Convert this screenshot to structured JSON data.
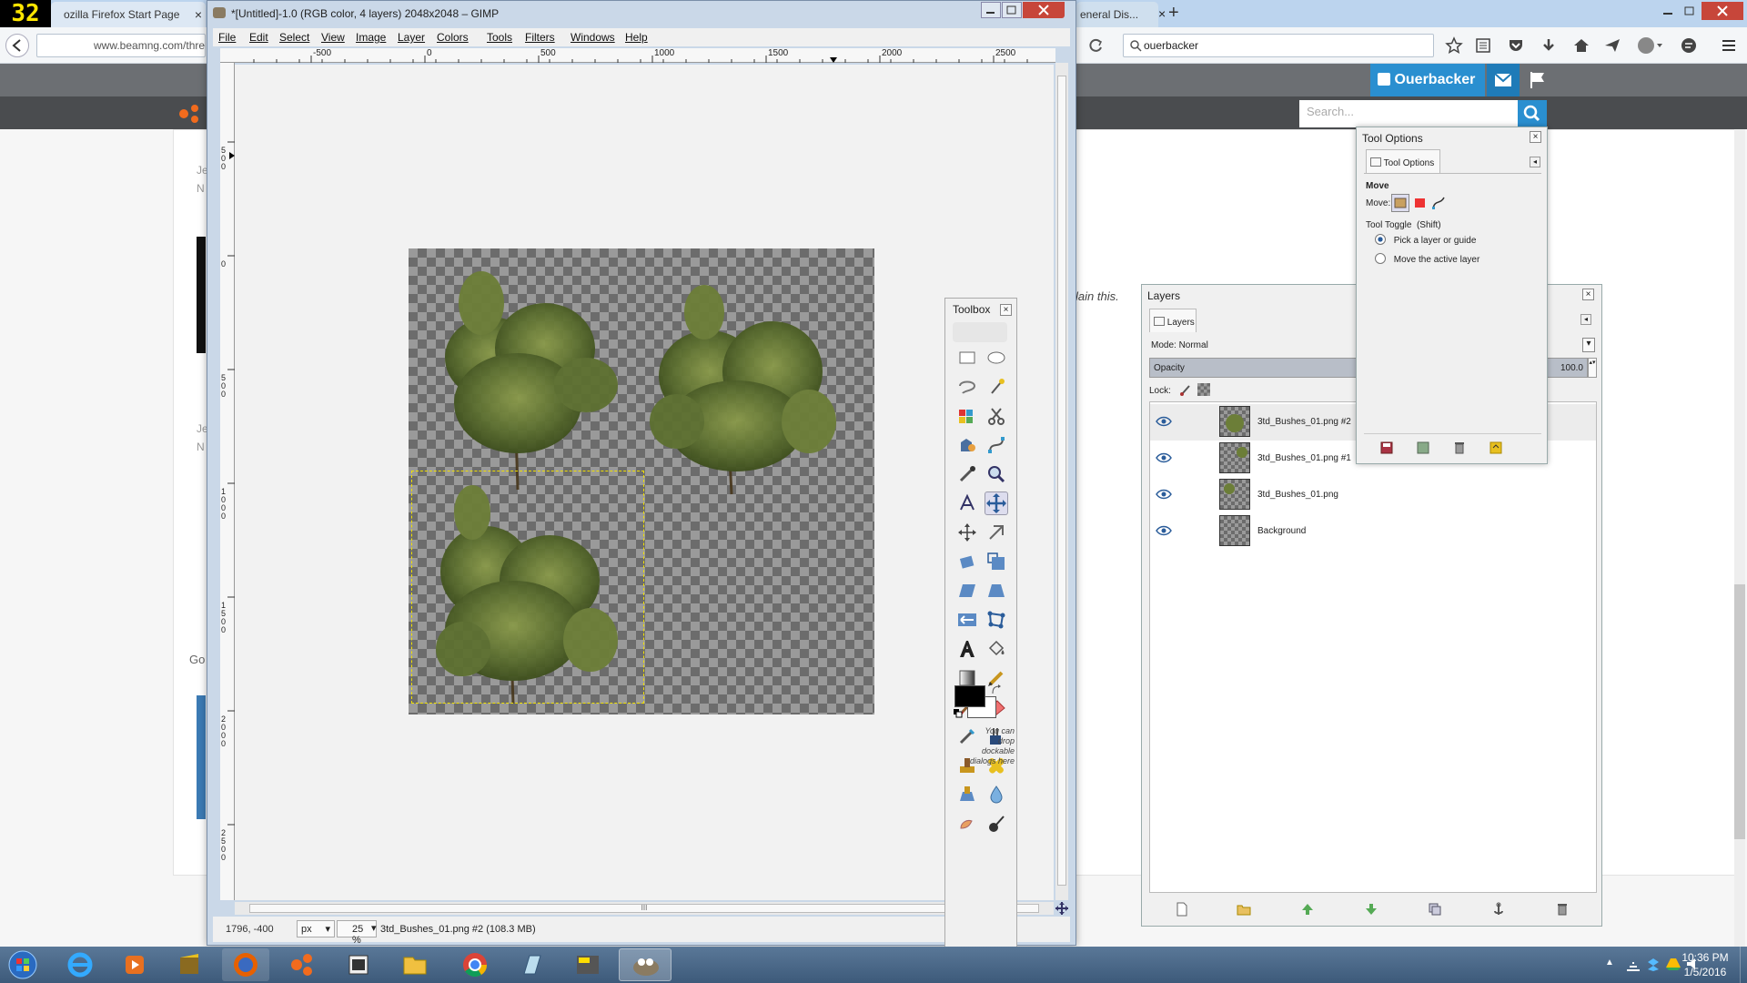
{
  "browser": {
    "tab_label": "ozilla Firefox Start Page",
    "right_tab_label": "eneral Dis...",
    "tab_close_glyph": "×",
    "new_tab_glyph": "+",
    "url": "www.beamng.com/thre",
    "search_value": "ouerbacker",
    "counter_badge": "32"
  },
  "site": {
    "user_name": "Ouerbacker",
    "search_placeholder": "Search...",
    "side_snippet_1": "Je",
    "side_snippet_2": "N",
    "side_snippet_3": "Je",
    "side_snippet_4": "N",
    "side_snippet_5": "Go",
    "explain_text": "lain this."
  },
  "gimp": {
    "title": "*[Untitled]-1.0 (RGB color, 4 layers) 2048x2048 – GIMP",
    "menus": [
      "File",
      "Edit",
      "Select",
      "View",
      "Image",
      "Layer",
      "Colors",
      "Tools",
      "Filters",
      "Windows",
      "Help"
    ],
    "ruler_labels": [
      "-500",
      "0",
      "500",
      "1000",
      "1500",
      "2000",
      "2500"
    ],
    "vruler_labels": [
      "500",
      "0",
      "500",
      "1000",
      "1500",
      "2000",
      "2500"
    ],
    "coords": "1796, -400",
    "unit": "px",
    "zoom": "25 %",
    "status": "3td_Bushes_01.png #2 (108.3 MB)",
    "scroll_grip": "III"
  },
  "toolbox": {
    "title": "Toolbox",
    "drop_hint": "You can drop dockable dialogs here"
  },
  "tool_options": {
    "window_title": "Tool Options",
    "tab_label": "Tool Options",
    "section": "Move",
    "move_label": "Move:",
    "toggle_label": "Tool Toggle  (Shift)",
    "option_pick": "Pick a layer or guide",
    "option_move": "Move the active layer",
    "selected_option": "pick"
  },
  "layers": {
    "window_title": "Layers",
    "tab_label": "Layers",
    "mode": "Mode: Normal",
    "opacity_label": "Opacity",
    "opacity_value": "100.0",
    "lock_label": "Lock:",
    "items": [
      {
        "name": "3td_Bushes_01.png #2",
        "active": true
      },
      {
        "name": "3td_Bushes_01.png #1",
        "active": false
      },
      {
        "name": "3td_Bushes_01.png",
        "active": false
      },
      {
        "name": "Background",
        "active": false
      }
    ]
  },
  "taskbar": {
    "time": "10:36 PM",
    "date": "1/5/2016"
  },
  "colors": {
    "gimp_frame": "#cad8e8",
    "site_accent": "#2a8fd0",
    "fg_color": "#000000",
    "bg_color": "#ffffff",
    "selection": "#f0e000"
  }
}
